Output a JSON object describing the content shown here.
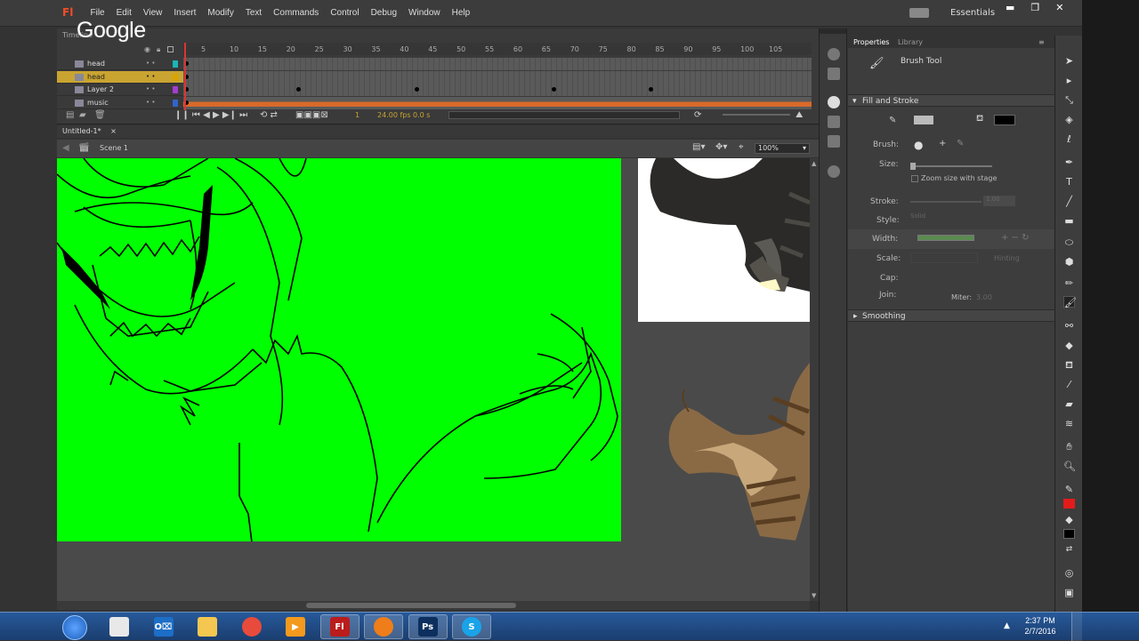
{
  "overlay": {
    "google_watermark": "Google"
  },
  "app": {
    "logo": "Fl",
    "workspace": "Essentials"
  },
  "menu": [
    "File",
    "Edit",
    "View",
    "Insert",
    "Modify",
    "Text",
    "Commands",
    "Control",
    "Debug",
    "Window",
    "Help"
  ],
  "timeline": {
    "panel_title": "Timeline",
    "ruler": [
      "5",
      "10",
      "15",
      "20",
      "25",
      "30",
      "35",
      "40",
      "45",
      "50",
      "55",
      "60",
      "65",
      "70",
      "75",
      "80",
      "85",
      "90",
      "95",
      "100",
      "105"
    ],
    "layers": [
      {
        "name": "head",
        "color": "#1cb5b5",
        "selected": false
      },
      {
        "name": "head",
        "color": "#d7a400",
        "selected": true
      },
      {
        "name": "Layer 2",
        "color": "#a33dcf",
        "selected": false
      },
      {
        "name": "music",
        "color": "#3364c9",
        "selected": false
      }
    ],
    "current_frame": "1",
    "fps": "24.00 fps",
    "time": "0.0 s"
  },
  "document": {
    "tab": "Untitled-1*",
    "close": "×",
    "scene": "Scene 1",
    "zoom": "100%"
  },
  "properties": {
    "tabs": [
      "Properties",
      "Library"
    ],
    "tool_name": "Brush Tool",
    "fill_stroke_header": "Fill and Stroke",
    "brush_label": "Brush:",
    "size_label": "Size:",
    "zoom_checkbox": "Zoom size with stage",
    "stroke_label": "Stroke:",
    "stroke_value": "1.00",
    "style_label": "Style:",
    "style_value": "Solid",
    "width_label": "Width:",
    "scale_label": "Scale:",
    "hinting_label": "Hinting",
    "cap_label": "Cap:",
    "join_label": "Join:",
    "miter_label": "Miter:",
    "miter_value": "3.00",
    "smoothing_header": "Smoothing",
    "fill_color": "#000000"
  },
  "taskbar": {
    "apps": [
      {
        "name": "notepad",
        "label": "",
        "color": "#e8e8e8"
      },
      {
        "name": "outlook",
        "label": "O⌧",
        "color": "#1d6ec7"
      },
      {
        "name": "explorer",
        "label": "",
        "color": "#f3c750"
      },
      {
        "name": "chrome",
        "label": "",
        "color": "#e84b3c"
      },
      {
        "name": "media",
        "label": "▶",
        "color": "#f39a1e"
      },
      {
        "name": "flash",
        "label": "Fl",
        "color": "#bb1c1c"
      },
      {
        "name": "firefox",
        "label": "",
        "color": "#ef7d1a"
      },
      {
        "name": "photoshop",
        "label": "Ps",
        "color": "#0c2f5e"
      },
      {
        "name": "skype",
        "label": "S",
        "color": "#1aa3e8"
      }
    ],
    "time": "2:37 PM",
    "date": "2/7/2016"
  }
}
